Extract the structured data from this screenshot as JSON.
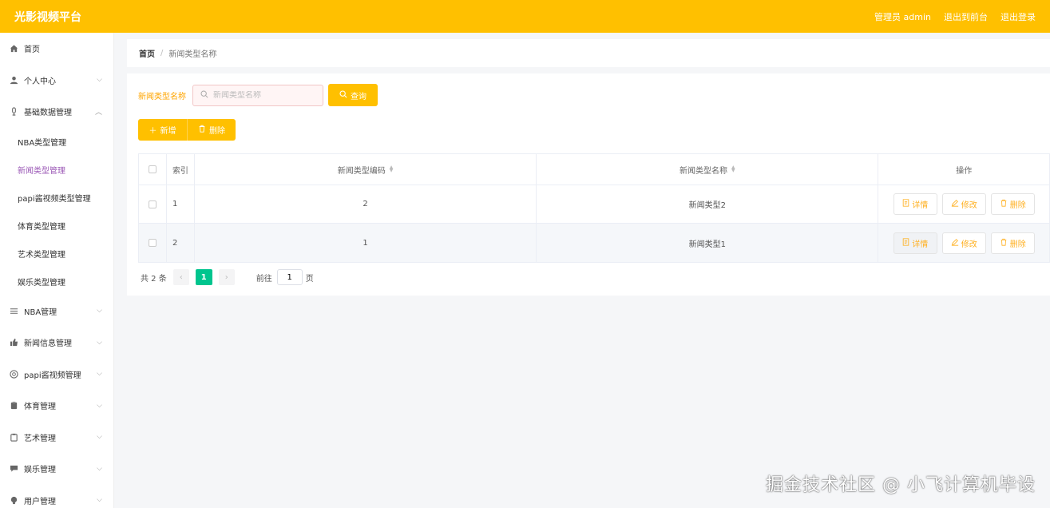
{
  "header": {
    "title": "光影视频平台",
    "admin_label": "管理员 admin",
    "front_label": "退出到前台",
    "logout_label": "退出登录"
  },
  "sidebar": {
    "items": [
      {
        "label": "首页",
        "icon": "home-icon"
      },
      {
        "label": "个人中心",
        "icon": "user-icon"
      },
      {
        "label": "基础数据管理",
        "icon": "mic-icon"
      },
      {
        "label": "NBA管理",
        "icon": "list-icon"
      },
      {
        "label": "新闻信息管理",
        "icon": "thumb-icon"
      },
      {
        "label": "papi酱视频管理",
        "icon": "aperture-icon"
      },
      {
        "label": "体育管理",
        "icon": "clipboard-icon"
      },
      {
        "label": "艺术管理",
        "icon": "clipboard-icon"
      },
      {
        "label": "娱乐管理",
        "icon": "chat-icon"
      },
      {
        "label": "用户管理",
        "icon": "bulb-icon"
      }
    ],
    "subitems": [
      {
        "label": "NBA类型管理"
      },
      {
        "label": "新闻类型管理"
      },
      {
        "label": "papi酱视频类型管理"
      },
      {
        "label": "体育类型管理"
      },
      {
        "label": "艺术类型管理"
      },
      {
        "label": "娱乐类型管理"
      }
    ]
  },
  "breadcrumb": {
    "home": "首页",
    "separator": "/",
    "current": "新闻类型名称"
  },
  "search": {
    "label": "新闻类型名称",
    "placeholder": "新闻类型名称",
    "button": "查询"
  },
  "actions": {
    "add": "新增",
    "delete": "删除"
  },
  "table": {
    "headers": {
      "index": "索引",
      "code": "新闻类型编码",
      "name": "新闻类型名称",
      "ops": "操作"
    },
    "rows": [
      {
        "index": "1",
        "code": "2",
        "name": "新闻类型2"
      },
      {
        "index": "2",
        "code": "1",
        "name": "新闻类型1"
      }
    ],
    "op_labels": {
      "detail": "详情",
      "edit": "修改",
      "delete": "删除"
    }
  },
  "pagination": {
    "total": "共 2 条",
    "current_page": "1",
    "goto_label": "前往",
    "goto_value": "1",
    "page_suffix": "页"
  },
  "watermark": "掘金技术社区 @ 小飞计算机毕设",
  "colors": {
    "accent": "#ffc000",
    "active_menu": "#9b59b6",
    "pager_active": "#00c58e"
  }
}
